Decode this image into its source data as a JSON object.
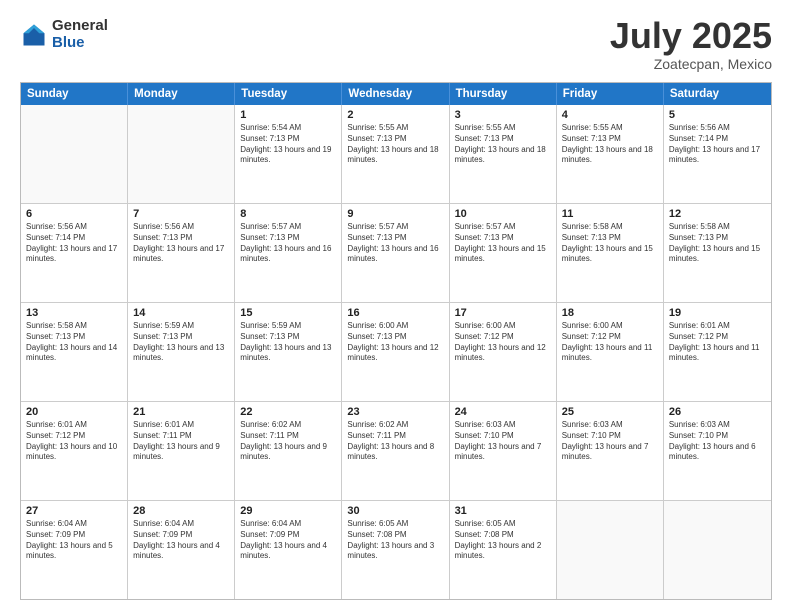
{
  "logo": {
    "general": "General",
    "blue": "Blue"
  },
  "header": {
    "month": "July 2025",
    "location": "Zoatecpan, Mexico"
  },
  "weekdays": [
    "Sunday",
    "Monday",
    "Tuesday",
    "Wednesday",
    "Thursday",
    "Friday",
    "Saturday"
  ],
  "rows": [
    [
      {
        "day": "",
        "sunrise": "",
        "sunset": "",
        "daylight": ""
      },
      {
        "day": "",
        "sunrise": "",
        "sunset": "",
        "daylight": ""
      },
      {
        "day": "1",
        "sunrise": "Sunrise: 5:54 AM",
        "sunset": "Sunset: 7:13 PM",
        "daylight": "Daylight: 13 hours and 19 minutes."
      },
      {
        "day": "2",
        "sunrise": "Sunrise: 5:55 AM",
        "sunset": "Sunset: 7:13 PM",
        "daylight": "Daylight: 13 hours and 18 minutes."
      },
      {
        "day": "3",
        "sunrise": "Sunrise: 5:55 AM",
        "sunset": "Sunset: 7:13 PM",
        "daylight": "Daylight: 13 hours and 18 minutes."
      },
      {
        "day": "4",
        "sunrise": "Sunrise: 5:55 AM",
        "sunset": "Sunset: 7:13 PM",
        "daylight": "Daylight: 13 hours and 18 minutes."
      },
      {
        "day": "5",
        "sunrise": "Sunrise: 5:56 AM",
        "sunset": "Sunset: 7:14 PM",
        "daylight": "Daylight: 13 hours and 17 minutes."
      }
    ],
    [
      {
        "day": "6",
        "sunrise": "Sunrise: 5:56 AM",
        "sunset": "Sunset: 7:14 PM",
        "daylight": "Daylight: 13 hours and 17 minutes."
      },
      {
        "day": "7",
        "sunrise": "Sunrise: 5:56 AM",
        "sunset": "Sunset: 7:13 PM",
        "daylight": "Daylight: 13 hours and 17 minutes."
      },
      {
        "day": "8",
        "sunrise": "Sunrise: 5:57 AM",
        "sunset": "Sunset: 7:13 PM",
        "daylight": "Daylight: 13 hours and 16 minutes."
      },
      {
        "day": "9",
        "sunrise": "Sunrise: 5:57 AM",
        "sunset": "Sunset: 7:13 PM",
        "daylight": "Daylight: 13 hours and 16 minutes."
      },
      {
        "day": "10",
        "sunrise": "Sunrise: 5:57 AM",
        "sunset": "Sunset: 7:13 PM",
        "daylight": "Daylight: 13 hours and 15 minutes."
      },
      {
        "day": "11",
        "sunrise": "Sunrise: 5:58 AM",
        "sunset": "Sunset: 7:13 PM",
        "daylight": "Daylight: 13 hours and 15 minutes."
      },
      {
        "day": "12",
        "sunrise": "Sunrise: 5:58 AM",
        "sunset": "Sunset: 7:13 PM",
        "daylight": "Daylight: 13 hours and 15 minutes."
      }
    ],
    [
      {
        "day": "13",
        "sunrise": "Sunrise: 5:58 AM",
        "sunset": "Sunset: 7:13 PM",
        "daylight": "Daylight: 13 hours and 14 minutes."
      },
      {
        "day": "14",
        "sunrise": "Sunrise: 5:59 AM",
        "sunset": "Sunset: 7:13 PM",
        "daylight": "Daylight: 13 hours and 13 minutes."
      },
      {
        "day": "15",
        "sunrise": "Sunrise: 5:59 AM",
        "sunset": "Sunset: 7:13 PM",
        "daylight": "Daylight: 13 hours and 13 minutes."
      },
      {
        "day": "16",
        "sunrise": "Sunrise: 6:00 AM",
        "sunset": "Sunset: 7:13 PM",
        "daylight": "Daylight: 13 hours and 12 minutes."
      },
      {
        "day": "17",
        "sunrise": "Sunrise: 6:00 AM",
        "sunset": "Sunset: 7:12 PM",
        "daylight": "Daylight: 13 hours and 12 minutes."
      },
      {
        "day": "18",
        "sunrise": "Sunrise: 6:00 AM",
        "sunset": "Sunset: 7:12 PM",
        "daylight": "Daylight: 13 hours and 11 minutes."
      },
      {
        "day": "19",
        "sunrise": "Sunrise: 6:01 AM",
        "sunset": "Sunset: 7:12 PM",
        "daylight": "Daylight: 13 hours and 11 minutes."
      }
    ],
    [
      {
        "day": "20",
        "sunrise": "Sunrise: 6:01 AM",
        "sunset": "Sunset: 7:12 PM",
        "daylight": "Daylight: 13 hours and 10 minutes."
      },
      {
        "day": "21",
        "sunrise": "Sunrise: 6:01 AM",
        "sunset": "Sunset: 7:11 PM",
        "daylight": "Daylight: 13 hours and 9 minutes."
      },
      {
        "day": "22",
        "sunrise": "Sunrise: 6:02 AM",
        "sunset": "Sunset: 7:11 PM",
        "daylight": "Daylight: 13 hours and 9 minutes."
      },
      {
        "day": "23",
        "sunrise": "Sunrise: 6:02 AM",
        "sunset": "Sunset: 7:11 PM",
        "daylight": "Daylight: 13 hours and 8 minutes."
      },
      {
        "day": "24",
        "sunrise": "Sunrise: 6:03 AM",
        "sunset": "Sunset: 7:10 PM",
        "daylight": "Daylight: 13 hours and 7 minutes."
      },
      {
        "day": "25",
        "sunrise": "Sunrise: 6:03 AM",
        "sunset": "Sunset: 7:10 PM",
        "daylight": "Daylight: 13 hours and 7 minutes."
      },
      {
        "day": "26",
        "sunrise": "Sunrise: 6:03 AM",
        "sunset": "Sunset: 7:10 PM",
        "daylight": "Daylight: 13 hours and 6 minutes."
      }
    ],
    [
      {
        "day": "27",
        "sunrise": "Sunrise: 6:04 AM",
        "sunset": "Sunset: 7:09 PM",
        "daylight": "Daylight: 13 hours and 5 minutes."
      },
      {
        "day": "28",
        "sunrise": "Sunrise: 6:04 AM",
        "sunset": "Sunset: 7:09 PM",
        "daylight": "Daylight: 13 hours and 4 minutes."
      },
      {
        "day": "29",
        "sunrise": "Sunrise: 6:04 AM",
        "sunset": "Sunset: 7:09 PM",
        "daylight": "Daylight: 13 hours and 4 minutes."
      },
      {
        "day": "30",
        "sunrise": "Sunrise: 6:05 AM",
        "sunset": "Sunset: 7:08 PM",
        "daylight": "Daylight: 13 hours and 3 minutes."
      },
      {
        "day": "31",
        "sunrise": "Sunrise: 6:05 AM",
        "sunset": "Sunset: 7:08 PM",
        "daylight": "Daylight: 13 hours and 2 minutes."
      },
      {
        "day": "",
        "sunrise": "",
        "sunset": "",
        "daylight": ""
      },
      {
        "day": "",
        "sunrise": "",
        "sunset": "",
        "daylight": ""
      }
    ]
  ]
}
